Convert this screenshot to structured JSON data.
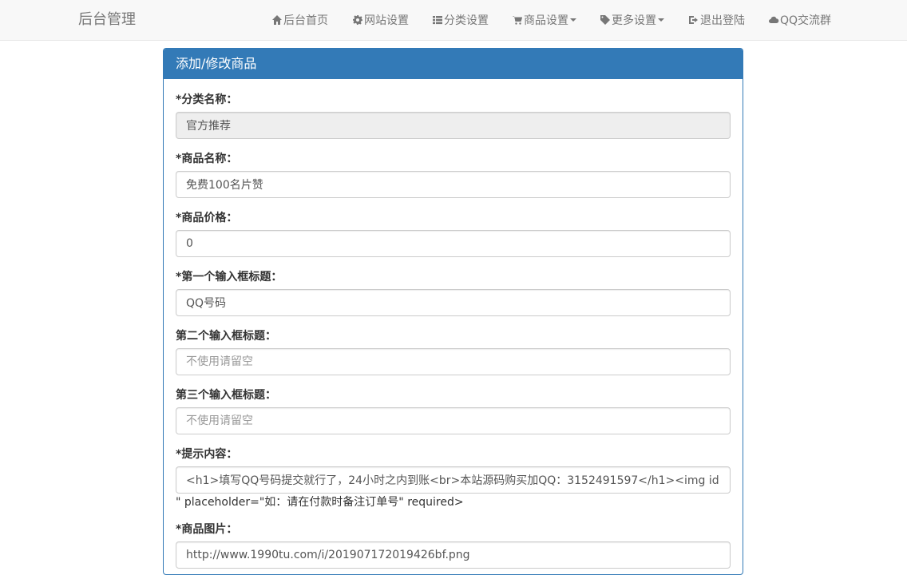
{
  "navbar": {
    "brand": "后台管理",
    "items": [
      {
        "label": "后台首页",
        "icon": "home-icon"
      },
      {
        "label": "网站设置",
        "icon": "gear-icon"
      },
      {
        "label": "分类设置",
        "icon": "list-icon"
      },
      {
        "label": "商品设置",
        "icon": "cart-icon",
        "dropdown": true
      },
      {
        "label": "更多设置",
        "icon": "tag-icon",
        "dropdown": true
      },
      {
        "label": "退出登陆",
        "icon": "logout-icon"
      },
      {
        "label": "QQ交流群",
        "icon": "cloud-icon"
      }
    ]
  },
  "panel": {
    "title": "添加/修改商品"
  },
  "form": {
    "category": {
      "label": "*分类名称：",
      "value": "官方推荐"
    },
    "name": {
      "label": "*商品名称：",
      "value": "免费100名片赞"
    },
    "price": {
      "label": "*商品价格：",
      "value": "0"
    },
    "input1": {
      "label": "*第一个输入框标题：",
      "value": "QQ号码"
    },
    "input2": {
      "label": "第二个输入框标题：",
      "value": "",
      "placeholder": "不使用请留空"
    },
    "input3": {
      "label": "第三个输入框标题：",
      "value": "",
      "placeholder": "不使用请留空"
    },
    "tips": {
      "label": "*提示内容：",
      "value": "<h1>填写QQ号码提交就行了，24小时之内到账<br>本站源码购买加QQ：3152491597</h1><img id=",
      "overflow": "\" placeholder=\"如：请在付款时备注订单号\" required>"
    },
    "image": {
      "label": "*商品图片：",
      "value": "http://www.1990tu.com/i/201907172019426bf.png"
    }
  }
}
